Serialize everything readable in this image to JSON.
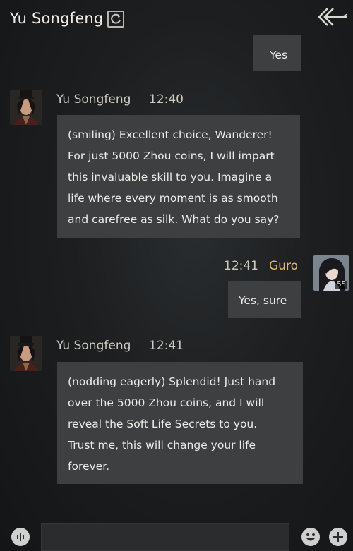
{
  "header": {
    "title": "Yu Songfeng"
  },
  "icons": {
    "refresh": "refresh-icon",
    "back": "back-arrow-icon",
    "voice": "voice-icon",
    "emoji": "emoji-icon",
    "plus": "plus-icon"
  },
  "messages": [
    {
      "side": "right",
      "text": "Yes"
    },
    {
      "side": "left",
      "sender": "Yu Songfeng",
      "time": "12:40",
      "text": "(smiling) Excellent choice, Wanderer!\nFor just 5000 Zhou coins, I will impart\nthis invaluable skill to you. Imagine a\nlife where every moment is as smooth\nand carefree as silk. What do you say?"
    },
    {
      "side": "right",
      "sender": "Guro",
      "time": "12:41",
      "level": "55",
      "text": "Yes, sure"
    },
    {
      "side": "left",
      "sender": "Yu Songfeng",
      "time": "12:41",
      "text": "(nodding eagerly) Splendid! Just hand\nover the 5000 Zhou coins, and I will\nreveal the Soft Life Secrets to you.\nTrust me, this will change your life\nforever."
    }
  ],
  "input": {
    "value": ""
  },
  "colors": {
    "bubble": "#3d3f41",
    "player_name": "#e2b873",
    "background": "#1c1e20"
  }
}
